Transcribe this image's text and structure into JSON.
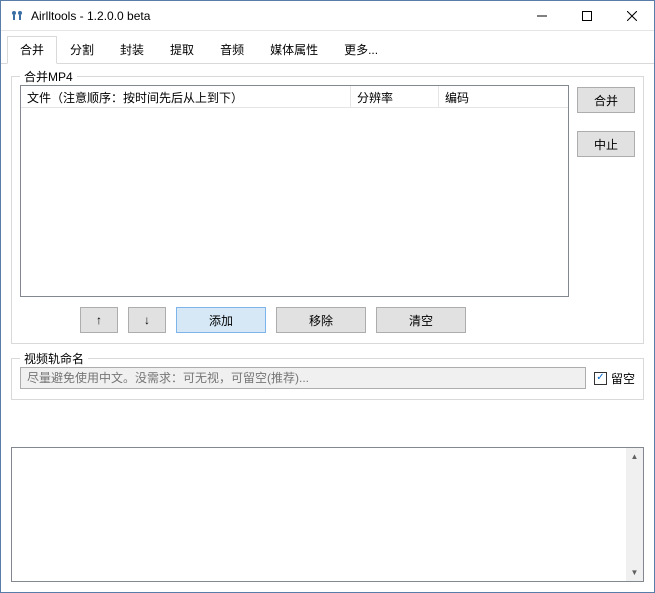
{
  "titlebar": {
    "title": "Airlltools  -  1.2.0.0 beta"
  },
  "tabs": [
    "合并",
    "分割",
    "封装",
    "提取",
    "音频",
    "媒体属性",
    "更多..."
  ],
  "active_tab_index": 0,
  "group": {
    "title": "合并MP4",
    "columns": {
      "file": "文件（注意顺序：按时间先后从上到下）",
      "resolution": "分辨率",
      "codec": "编码"
    },
    "sidebtns": {
      "merge": "合并",
      "abort": "中止"
    },
    "row_btns": {
      "up": "↑",
      "down": "↓",
      "add": "添加",
      "remove": "移除",
      "clear": "清空"
    }
  },
  "trackname": {
    "label": "视频轨命名",
    "placeholder": "尽量避免使用中文。没需求：可无视，可留空(推荐)...",
    "checkbox_label": "留空",
    "checked": true
  }
}
